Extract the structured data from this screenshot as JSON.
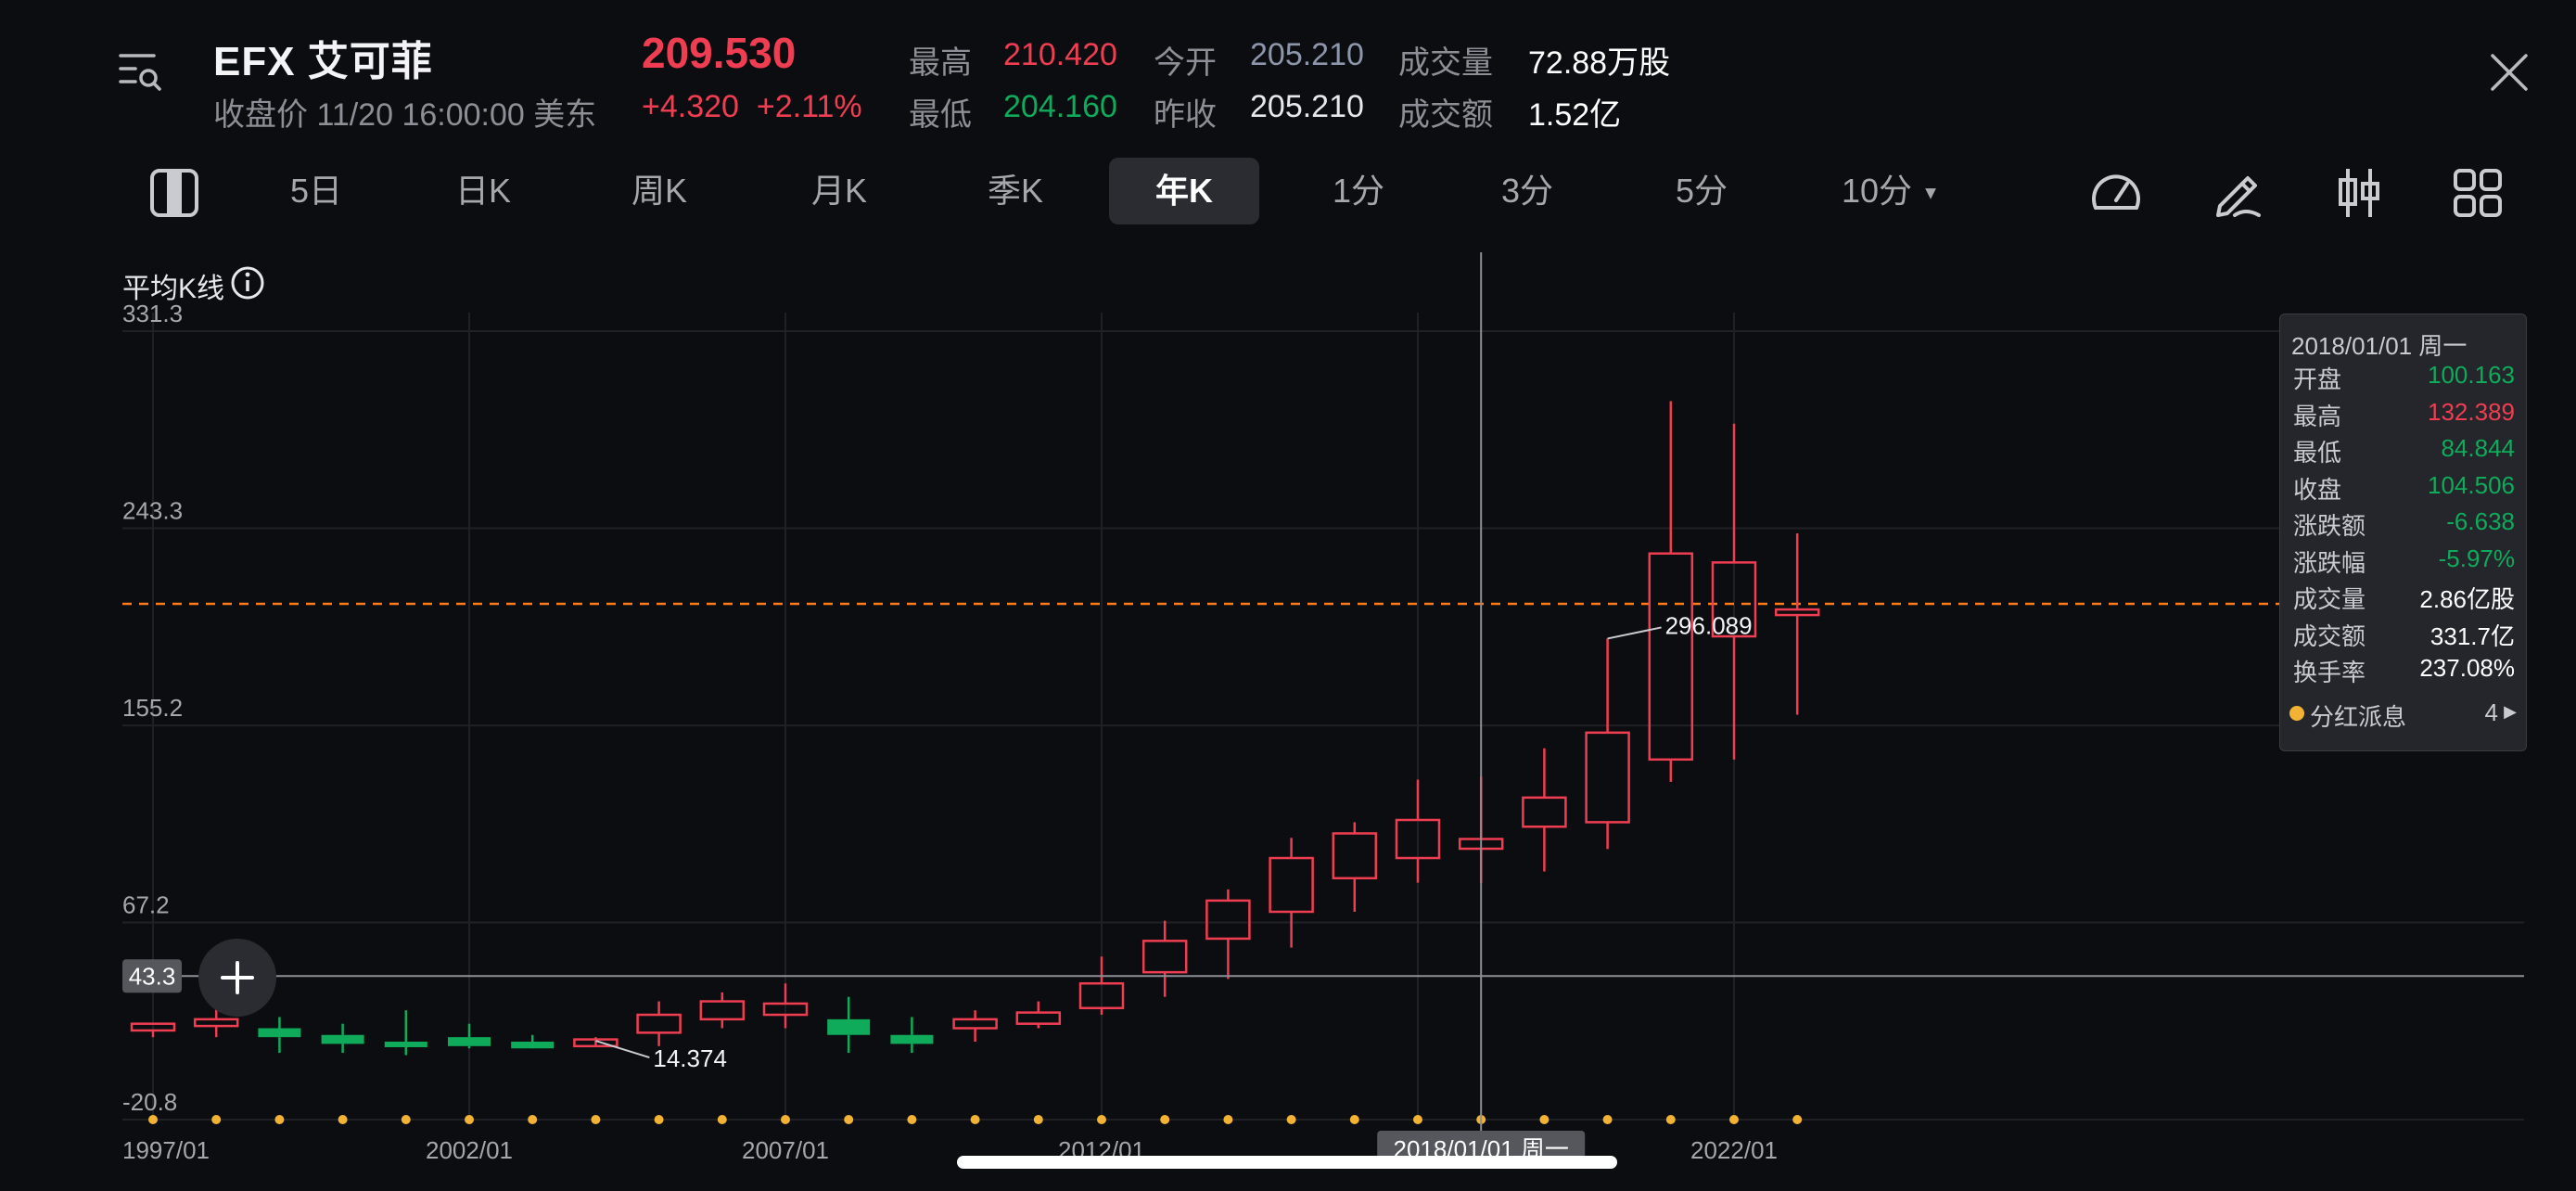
{
  "header": {
    "symbol": "EFX  艾可菲",
    "close_info": "收盘价 11/20 16:00:00 美东",
    "price": "209.530",
    "change": "+4.320",
    "change_pct": "+2.11%",
    "high_label": "最高",
    "high_value": "210.420",
    "low_label": "最低",
    "low_value": "204.160",
    "open_label": "今开",
    "open_value": "205.210",
    "prev_close_label": "昨收",
    "prev_close_value": "205.210",
    "volume_label": "成交量",
    "volume_value": "72.88万股",
    "turnover_label": "成交额",
    "turnover_value": "1.52亿"
  },
  "icons": {
    "menu": "menu-search-icon",
    "close": "close-icon",
    "layout": "panel-toggle-icon",
    "gauge": "gauge-icon",
    "draw": "pen-icon",
    "indicator": "candle-indicator-icon",
    "grid": "grid-icon",
    "crosshair": "crosshair-plus-icon",
    "info": "info-icon"
  },
  "tabs": [
    {
      "label": "5日",
      "active": false
    },
    {
      "label": "日K",
      "active": false
    },
    {
      "label": "周K",
      "active": false
    },
    {
      "label": "月K",
      "active": false
    },
    {
      "label": "季K",
      "active": false
    },
    {
      "label": "年K",
      "active": true
    },
    {
      "label": "1分",
      "active": false
    },
    {
      "label": "3分",
      "active": false
    },
    {
      "label": "5分",
      "active": false
    },
    {
      "label": "10分",
      "active": false
    }
  ],
  "chart_label": "平均K线",
  "colors": {
    "up": "#ef3d52",
    "down": "#0fab5b",
    "accent": "#ff7a1a",
    "dividend": "#f2b233"
  },
  "chart_data": {
    "type": "candlestick",
    "x": [
      "1997",
      "1998",
      "1999",
      "2000",
      "2001",
      "2002",
      "2003",
      "2004",
      "2005",
      "2006",
      "2007",
      "2008",
      "2009",
      "2010",
      "2011",
      "2012",
      "2013",
      "2014",
      "2015",
      "2016",
      "2017",
      "2018",
      "2019",
      "2020",
      "2021",
      "2022",
      "2023"
    ],
    "open": [
      19,
      21,
      20,
      17,
      14,
      16,
      14,
      12,
      18,
      24,
      26,
      24,
      17,
      20,
      22,
      29,
      45,
      60,
      72,
      87,
      96,
      100.163,
      110,
      112,
      140,
      195,
      205
    ],
    "high": [
      22,
      31,
      25,
      22,
      28,
      22,
      17,
      16,
      32,
      36,
      40,
      34,
      25,
      28,
      32,
      52,
      68,
      82,
      105,
      112,
      131,
      132.389,
      145,
      194,
      300,
      290,
      241
    ],
    "low": [
      16,
      16,
      9,
      9,
      8,
      11,
      12,
      14.374,
      12,
      20,
      20,
      9,
      9,
      14,
      20,
      26,
      34,
      42,
      56,
      72,
      85,
      84.844,
      90,
      100,
      130,
      140,
      160
    ],
    "close": [
      22,
      24,
      16,
      13,
      13,
      12,
      11,
      15,
      26,
      32,
      31,
      17,
      13,
      24,
      27,
      40,
      59,
      77,
      96,
      107,
      113,
      104.506,
      123,
      152,
      232,
      228,
      207
    ],
    "y_ticks": [
      331.3,
      243.3,
      155.2,
      67.2,
      -20.8
    ],
    "ylim": [
      -20.8,
      331.3
    ],
    "x_tick_labels": [
      "1997/01",
      "2002/01",
      "2007/01",
      "2012/01",
      "2022/01"
    ],
    "reference_line": 209.53,
    "crosshair_y": 43.3,
    "crosshair_y_label": "43.3",
    "crosshair_x": "2018",
    "crosshair_x_label": "2018/01/01 周一",
    "max_annotation": {
      "label": "296.089",
      "at": "2020"
    },
    "min_annotation": {
      "label": "14.374",
      "at": "2004"
    }
  },
  "info_panel": {
    "date": "2018/01/01 周一",
    "rows": [
      {
        "k": "开盘",
        "v": "100.163",
        "c": "down"
      },
      {
        "k": "最高",
        "v": "132.389",
        "c": "up"
      },
      {
        "k": "最低",
        "v": "84.844",
        "c": "down"
      },
      {
        "k": "收盘",
        "v": "104.506",
        "c": "down"
      },
      {
        "k": "涨跌额",
        "v": "-6.638",
        "c": "down"
      },
      {
        "k": "涨跌幅",
        "v": "-5.97%",
        "c": "down"
      },
      {
        "k": "成交量",
        "v": "2.86亿股",
        "c": "plain"
      },
      {
        "k": "成交额",
        "v": "331.7亿",
        "c": "plain"
      },
      {
        "k": "换手率",
        "v": "237.08%",
        "c": "plain"
      }
    ],
    "dividend_label": "分红派息",
    "dividend_count": "4"
  }
}
